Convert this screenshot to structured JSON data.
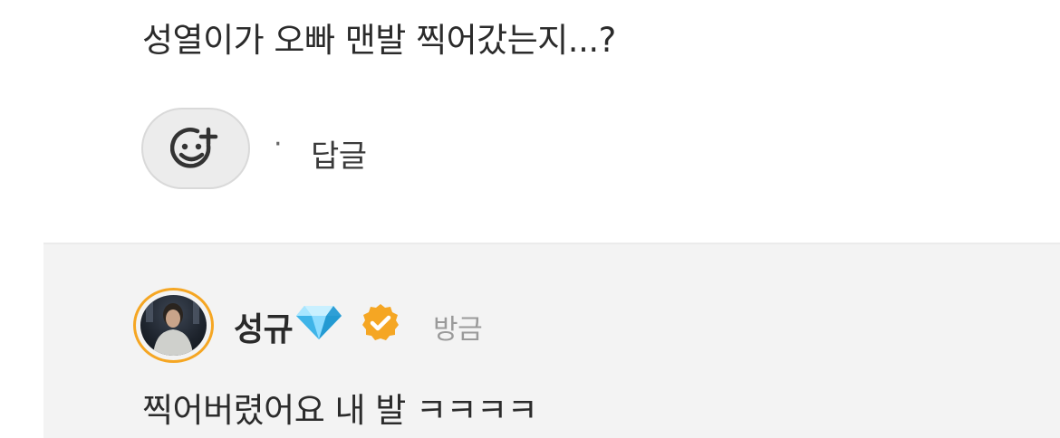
{
  "comment": {
    "text": "성열이가 오빠 맨발 찍어갔는지...?",
    "reaction_icon": "add-reaction-smiley-icon",
    "separator": "·",
    "reply_label": "답글"
  },
  "reply": {
    "username": "성규",
    "badge_icon": "gem-icon",
    "verified_icon": "verified-check-icon",
    "timestamp": "방금",
    "text": "찍어버렸어요 내 발 ㅋㅋㅋㅋ"
  },
  "colors": {
    "accent": "#f5a623",
    "gem": "#5ec8f5",
    "reply_background": "#f3f3f3"
  }
}
